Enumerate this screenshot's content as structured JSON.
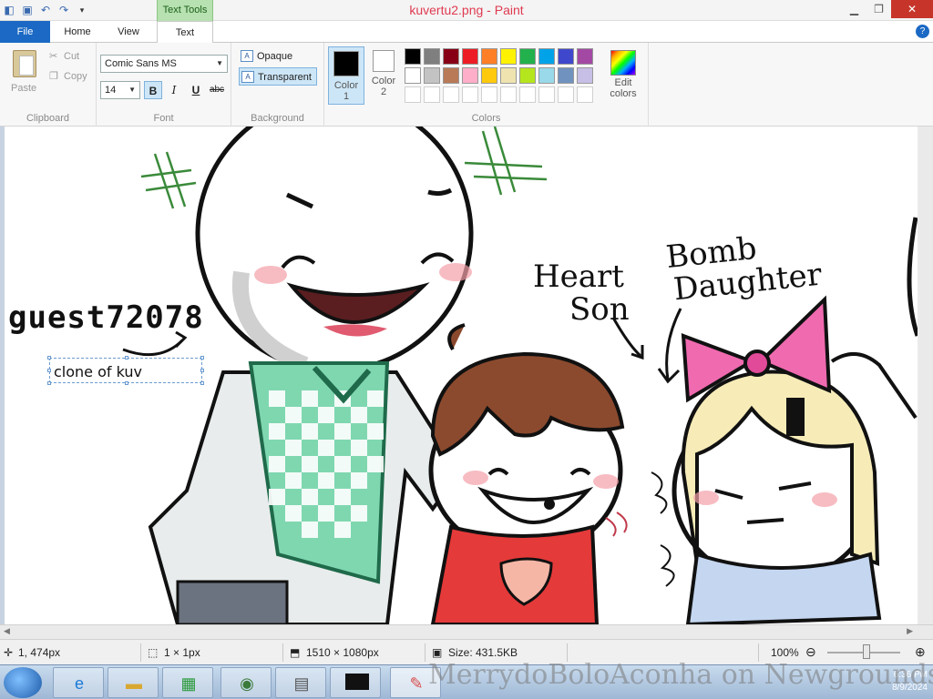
{
  "window": {
    "title": "kuvertu2.png - Paint",
    "context_tab": "Text Tools"
  },
  "tabs": [
    {
      "label": "File"
    },
    {
      "label": "Home"
    },
    {
      "label": "View"
    },
    {
      "label": "Text"
    }
  ],
  "ribbon": {
    "clipboard": {
      "paste": "Paste",
      "cut": "Cut",
      "copy": "Copy",
      "group": "Clipboard"
    },
    "font": {
      "family": "Comic Sans MS",
      "size": "14",
      "bold": "B",
      "italic": "I",
      "underline": "U",
      "strike": "abc",
      "group": "Font"
    },
    "background": {
      "opaque": "Opaque",
      "transparent": "Transparent",
      "group": "Background"
    },
    "colors": {
      "color1_label": "Color 1",
      "color2_label": "Color 2",
      "color1": "#000000",
      "color2": "#ffffff",
      "edit": "Edit colors",
      "group": "Colors",
      "palette_row1": [
        "#000000",
        "#7f7f7f",
        "#880015",
        "#ed1c24",
        "#ff7f27",
        "#fff200",
        "#22b14c",
        "#00a2e8",
        "#3f48cc",
        "#a349a4"
      ],
      "palette_row2": [
        "#ffffff",
        "#c3c3c3",
        "#b97a57",
        "#ffaec9",
        "#ffc90e",
        "#efe4b0",
        "#b5e61d",
        "#99d9ea",
        "#7092be",
        "#c8bfe7"
      ]
    }
  },
  "canvas": {
    "username": "guest72078",
    "text_box": "clone of kuv",
    "label_heart": "Heart",
    "label_son": "Son",
    "label_bomb": "Bomb",
    "label_daughter": "Daughter"
  },
  "status": {
    "position": "1, 474px",
    "selection": "1 × 1px",
    "dimensions": "1510 × 1080px",
    "size": "Size: 431.5KB",
    "zoom": "100%"
  },
  "taskbar": {
    "time": "6:36 PM",
    "date": "8/9/2024"
  },
  "watermark": "MerrydoBoloAconha on Newgrounds"
}
